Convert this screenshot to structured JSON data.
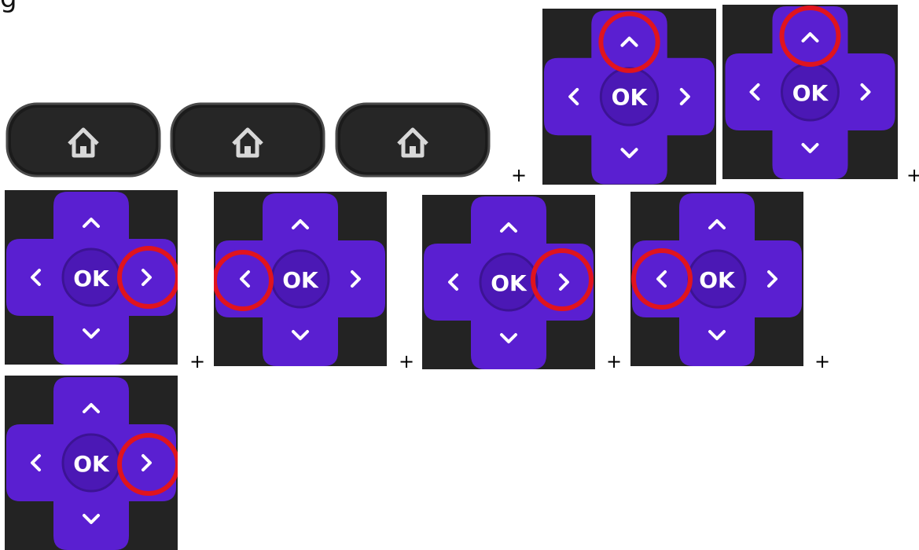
{
  "caption": "g",
  "home_buttons": [
    {
      "icon": "home-icon"
    },
    {
      "icon": "home-icon"
    },
    {
      "icon": "home-icon"
    }
  ],
  "dpad_steps": [
    {
      "ok_label": "OK",
      "highlight": "up"
    },
    {
      "ok_label": "OK",
      "highlight": "up"
    },
    {
      "ok_label": "OK",
      "highlight": "right"
    },
    {
      "ok_label": "OK",
      "highlight": "left"
    },
    {
      "ok_label": "OK",
      "highlight": "right"
    },
    {
      "ok_label": "OK",
      "highlight": "left"
    },
    {
      "ok_label": "OK",
      "highlight": "right"
    }
  ],
  "separator": "+",
  "colors": {
    "dpad_purple": "#5a1fd1",
    "remote_body": "#232323",
    "highlight_ring": "#e0141e"
  }
}
